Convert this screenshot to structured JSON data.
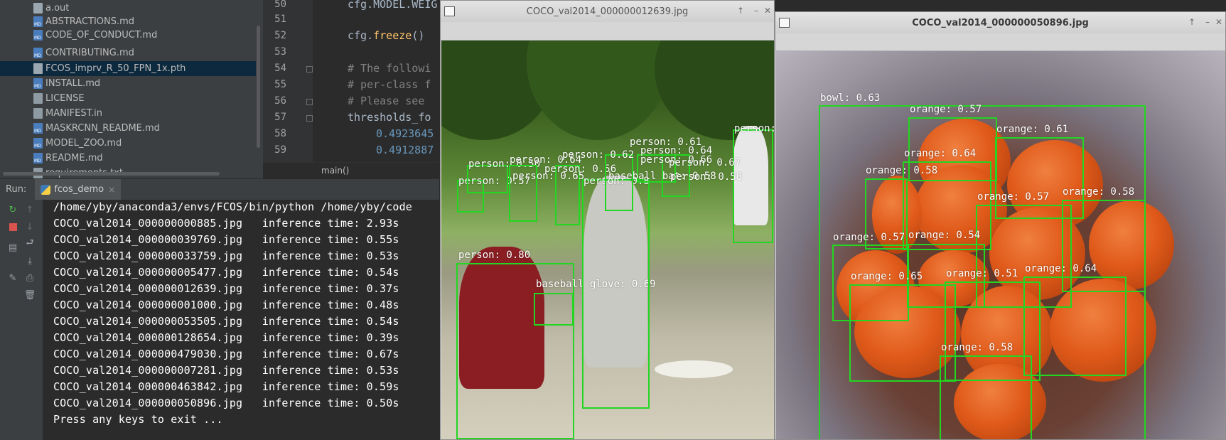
{
  "project_tree": {
    "items": [
      {
        "name": "a.out",
        "type": "bin",
        "selected": false
      },
      {
        "name": "ABSTRACTIONS.md",
        "type": "md",
        "selected": false
      },
      {
        "name": "CODE_OF_CONDUCT.md",
        "type": "md",
        "selected": false
      },
      {
        "name": "CONTRIBUTING.md",
        "type": "md",
        "selected": false
      },
      {
        "name": "FCOS_imprv_R_50_FPN_1x.pth",
        "type": "bin",
        "selected": true
      },
      {
        "name": "INSTALL.md",
        "type": "md",
        "selected": false
      },
      {
        "name": "LICENSE",
        "type": "txt",
        "selected": false
      },
      {
        "name": "MANIFEST.in",
        "type": "txt",
        "selected": false
      },
      {
        "name": "MASKRCNN_README.md",
        "type": "md",
        "selected": false
      },
      {
        "name": "MODEL_ZOO.md",
        "type": "md",
        "selected": false
      },
      {
        "name": "README.md",
        "type": "md",
        "selected": false
      },
      {
        "name": "requirements.txt",
        "type": "txt",
        "selected": false
      }
    ]
  },
  "editor": {
    "line_numbers": [
      "50",
      "51",
      "52",
      "53",
      "54",
      "55",
      "56",
      "57",
      "58",
      "59"
    ],
    "lines": {
      "l50": "cfg.MODEL.WEIG",
      "l52_fn": "freeze",
      "l52_pre": "cfg.",
      "l52_post": "()",
      "l54": "# The followi",
      "l55": "# per-class f",
      "l56": "# Please see",
      "l57": "thresholds_fo",
      "l58": "0.4923645",
      "l59": "0.4912887"
    },
    "breadcrumb": "main()"
  },
  "run_panel": {
    "label": "Run:",
    "tab_name": "fcos_demo",
    "close_glyph": "×",
    "console_lines": [
      "/home/yby/anaconda3/envs/FCOS/bin/python /home/yby/code",
      "COCO_val2014_000000000885.jpg   inference time: 2.93s",
      "COCO_val2014_000000039769.jpg   inference time: 0.55s",
      "COCO_val2014_000000033759.jpg   inference time: 0.53s",
      "COCO_val2014_000000005477.jpg   inference time: 0.54s",
      "COCO_val2014_000000012639.jpg   inference time: 0.37s",
      "COCO_val2014_000000001000.jpg   inference time: 0.48s",
      "COCO_val2014_000000053505.jpg   inference time: 0.54s",
      "COCO_val2014_000000128654.jpg   inference time: 0.39s",
      "COCO_val2014_000000479030.jpg   inference time: 0.67s",
      "COCO_val2014_000000007281.jpg   inference time: 0.53s",
      "COCO_val2014_000000463842.jpg   inference time: 0.59s",
      "COCO_val2014_000000050896.jpg   inference time: 0.50s",
      "Press any keys to exit ..."
    ]
  },
  "window1": {
    "title": "COCO_val2014_000000012639.jpg",
    "labels": [
      "person: 0.80",
      "baseball glove: 0.69",
      "person: 0.67",
      "person: 0.61",
      "person: 0.62",
      "person: 0.56",
      "person: 0.65",
      "person: 0.57",
      "person: 0.50",
      "person: 0.64",
      "baseball bat: 0.58",
      "person: 0.58",
      "person: 0.64",
      "person: 0.66",
      "person: 0.67",
      "person: 0.8"
    ]
  },
  "window2": {
    "title": "COCO_val2014_000000050896.jpg",
    "labels": [
      "bowl: 0.63",
      "orange: 0.57",
      "orange: 0.61",
      "orange: 0.64",
      "orange: 0.58",
      "orange: 0.57",
      "orange: 0.58",
      "orange: 0.57",
      "orange: 0.54",
      "orange: 0.65",
      "orange: 0.51",
      "orange: 0.64",
      "orange: 0.58"
    ]
  },
  "colors": {
    "detection_box": "#22d622",
    "console_bg": "#2b2b2b",
    "selected_row": "#0d293e"
  }
}
